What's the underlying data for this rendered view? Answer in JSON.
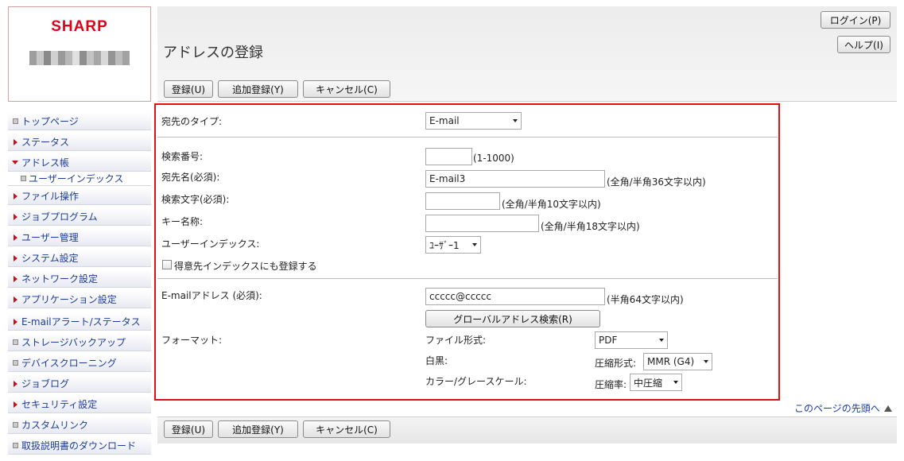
{
  "brand": {
    "logo_text": "SHARP"
  },
  "header": {
    "title": "アドレスの登録",
    "login_label": "ログイン(P)",
    "help_label": "ヘルプ(I)"
  },
  "actions": {
    "register_label": "登録(U)",
    "add_register_label": "追加登録(Y)",
    "cancel_label": "キャンセル(C)"
  },
  "sidebar": {
    "items": [
      {
        "label": "トップページ",
        "marker": "square"
      },
      {
        "label": "ステータス",
        "marker": "arrow"
      },
      {
        "label": "アドレス帳",
        "marker": "arrow-down"
      },
      {
        "label": "ユーザーインデックス",
        "marker": "square"
      },
      {
        "label": "ファイル操作",
        "marker": "arrow"
      },
      {
        "label": "ジョブプログラム",
        "marker": "arrow"
      },
      {
        "label": "ユーザー管理",
        "marker": "arrow"
      },
      {
        "label": "システム設定",
        "marker": "arrow"
      },
      {
        "label": "ネットワーク設定",
        "marker": "arrow"
      },
      {
        "label": "アプリケーション設定",
        "marker": "arrow"
      },
      {
        "label": "E-mailアラート/ステータス",
        "marker": "arrow"
      },
      {
        "label": "ストレージバックアップ",
        "marker": "square"
      },
      {
        "label": "デバイスクローニング",
        "marker": "square"
      },
      {
        "label": "ジョブログ",
        "marker": "arrow"
      },
      {
        "label": "セキュリティ設定",
        "marker": "arrow"
      },
      {
        "label": "カスタムリンク",
        "marker": "square"
      },
      {
        "label": "取扱説明書のダウンロード",
        "marker": "square"
      }
    ]
  },
  "form": {
    "dest_type_label": "宛先のタイプ:",
    "dest_type_value": "E-mail",
    "search_no_label": "検索番号:",
    "search_no_value": "",
    "search_no_hint": "(1-1000)",
    "name_label": "宛先名(必須):",
    "name_value": "E-mail3",
    "name_hint": "(全角/半角36文字以内)",
    "search_char_label": "検索文字(必須):",
    "search_char_value": "",
    "search_char_hint": "(全角/半角10文字以内)",
    "key_name_label": "キー名称:",
    "key_name_value": "",
    "key_name_hint": "(全角/半角18文字以内)",
    "user_index_label": "ユーザーインデックス:",
    "user_index_value": "ﾕｰｻﾞｰ1",
    "favorite_label": "得意先インデックスにも登録する",
    "favorite_checked": false,
    "email_label": "E-mailアドレス (必須):",
    "email_value": "ccccc@ccccc",
    "email_hint": "(半角64文字以内)",
    "global_search_label": "グローバルアドレス検索(R)",
    "format_label": "フォーマット:",
    "file_type_label": "ファイル形式:",
    "file_type_value": "PDF",
    "mono_label": "白黒:",
    "compress_label": "圧縮形式:",
    "compress_value": "MMR (G4)",
    "color_label": "カラー/グレースケール:",
    "ratio_label": "圧縮率:",
    "ratio_value": "中圧縮"
  },
  "footer": {
    "page_top_label": "このページの先頭へ"
  },
  "colors": {
    "brand_red": "#e0001a",
    "frame_red": "#e01010",
    "link_blue": "#1a3c9a"
  }
}
